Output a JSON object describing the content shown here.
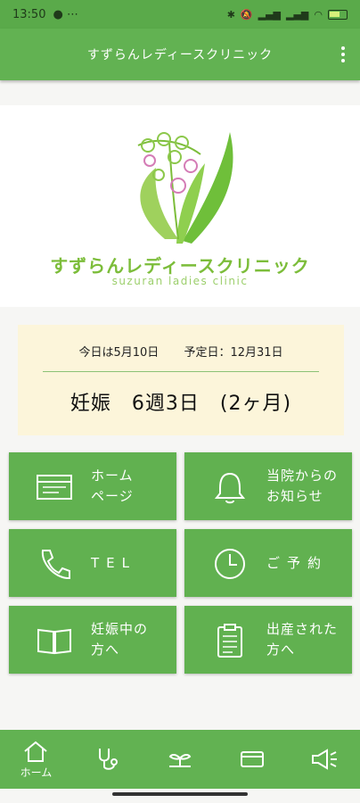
{
  "status": {
    "time": "13:50",
    "battery": "73"
  },
  "appbar": {
    "title": "すずらんレディースクリニック"
  },
  "logo": {
    "name_jp": "すずらんレディースクリニック",
    "name_en": "suzuran ladies clinic"
  },
  "pregnancy": {
    "today": "今日は5月10日",
    "due": "予定日：12月31日",
    "status": "妊娠　6週3日　(2ヶ月)"
  },
  "tiles": {
    "homepage": "ホーム\nページ",
    "news": "当院からの\nお知らせ",
    "tel": "TEL",
    "reservation": "ご予約",
    "pregnant": "妊娠中の\n方へ",
    "delivered": "出産された\n方へ"
  },
  "nav": {
    "home": "ホーム"
  },
  "icons": [
    "homepage-icon",
    "bell-icon",
    "phone-icon",
    "clock-icon",
    "book-icon",
    "clipboard-icon",
    "home-icon",
    "stethoscope-icon",
    "sprout-icon",
    "card-icon",
    "megaphone-icon"
  ],
  "colors": {
    "primary": "#62b252",
    "card": "#fcf5da",
    "logo_green": "#7cbd3a"
  }
}
